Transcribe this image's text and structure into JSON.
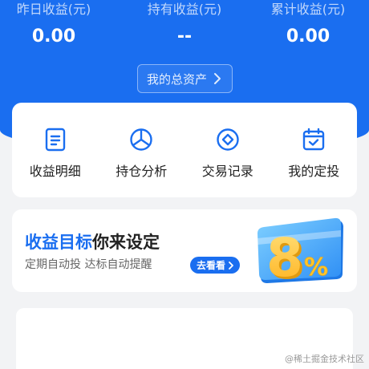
{
  "header": {
    "stats": [
      {
        "label": "昨日收益(元)",
        "value": "0.00"
      },
      {
        "label": "持有收益(元)",
        "value": "--"
      },
      {
        "label": "累计收益(元)",
        "value": "0.00"
      }
    ],
    "assets_button": "我的总资产"
  },
  "menu": [
    {
      "label": "收益明细",
      "icon": "document-icon"
    },
    {
      "label": "持仓分析",
      "icon": "pie-chart-icon"
    },
    {
      "label": "交易记录",
      "icon": "diamond-circle-icon"
    },
    {
      "label": "我的定投",
      "icon": "calendar-check-icon"
    }
  ],
  "goal_card": {
    "title_accent": "收益目标",
    "title_rest": "你来设定",
    "subtitle": "定期自动投 达标自动提醒",
    "button": "去看看",
    "art_text": "8%"
  },
  "watermark": "@稀土掘金技术社区",
  "colors": {
    "brand_blue": "#1a6ef0",
    "art_gold": "#ffc52b"
  }
}
